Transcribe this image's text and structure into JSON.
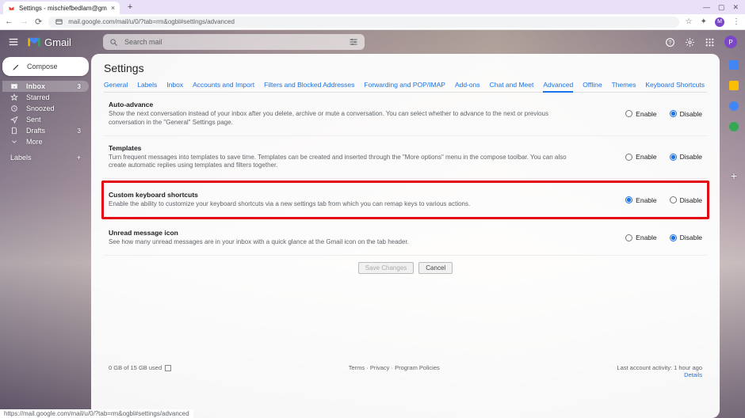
{
  "browser": {
    "tab_title": "Settings - mischiefbedlam@gm",
    "url": "mail.google.com/mail/u/0/?tab=rm&ogbl#settings/advanced",
    "status_url": "https://mail.google.com/mail/u/0/?tab=rm&ogbl#settings/advanced",
    "profile_initial": "M"
  },
  "gmail": {
    "brand": "Gmail",
    "search_placeholder": "Search mail",
    "avatar_initial": "P"
  },
  "sidebar": {
    "compose": "Compose",
    "items": [
      {
        "label": "Inbox",
        "count": "3"
      },
      {
        "label": "Starred",
        "count": ""
      },
      {
        "label": "Snoozed",
        "count": ""
      },
      {
        "label": "Sent",
        "count": ""
      },
      {
        "label": "Drafts",
        "count": "3"
      },
      {
        "label": "More",
        "count": ""
      }
    ],
    "labels_header": "Labels"
  },
  "settings": {
    "title": "Settings",
    "tabs": [
      "General",
      "Labels",
      "Inbox",
      "Accounts and Import",
      "Filters and Blocked Addresses",
      "Forwarding and POP/IMAP",
      "Add-ons",
      "Chat and Meet",
      "Advanced",
      "Offline",
      "Themes",
      "Keyboard Shortcuts"
    ],
    "active_tab_index": 8,
    "option_enable": "Enable",
    "option_disable": "Disable",
    "blocks": [
      {
        "title": "Auto-advance",
        "desc": "Show the next conversation instead of your inbox after you delete, archive or mute a conversation. You can select whether to advance to the next or previous conversation in the \"General\" Settings page.",
        "selected": "disable",
        "highlight": false
      },
      {
        "title": "Templates",
        "desc": "Turn frequent messages into templates to save time. Templates can be created and inserted through the \"More options\" menu in the compose toolbar. You can also create automatic replies using templates and filters together.",
        "selected": "disable",
        "highlight": false
      },
      {
        "title": "Custom keyboard shortcuts",
        "desc": "Enable the ability to customize your keyboard shortcuts via a new settings tab from which you can remap keys to various actions.",
        "selected": "enable",
        "highlight": true
      },
      {
        "title": "Unread message icon",
        "desc": "See how many unread messages are in your inbox with a quick glance at the Gmail icon on the tab header.",
        "selected": "disable",
        "highlight": false
      }
    ],
    "save_label": "Save Changes",
    "cancel_label": "Cancel",
    "footer_left": "0 GB of 15 GB used",
    "footer_mid": "Terms · Privacy · Program Policies",
    "footer_right1": "Last account activity: 1 hour ago",
    "footer_right2": "Details"
  }
}
